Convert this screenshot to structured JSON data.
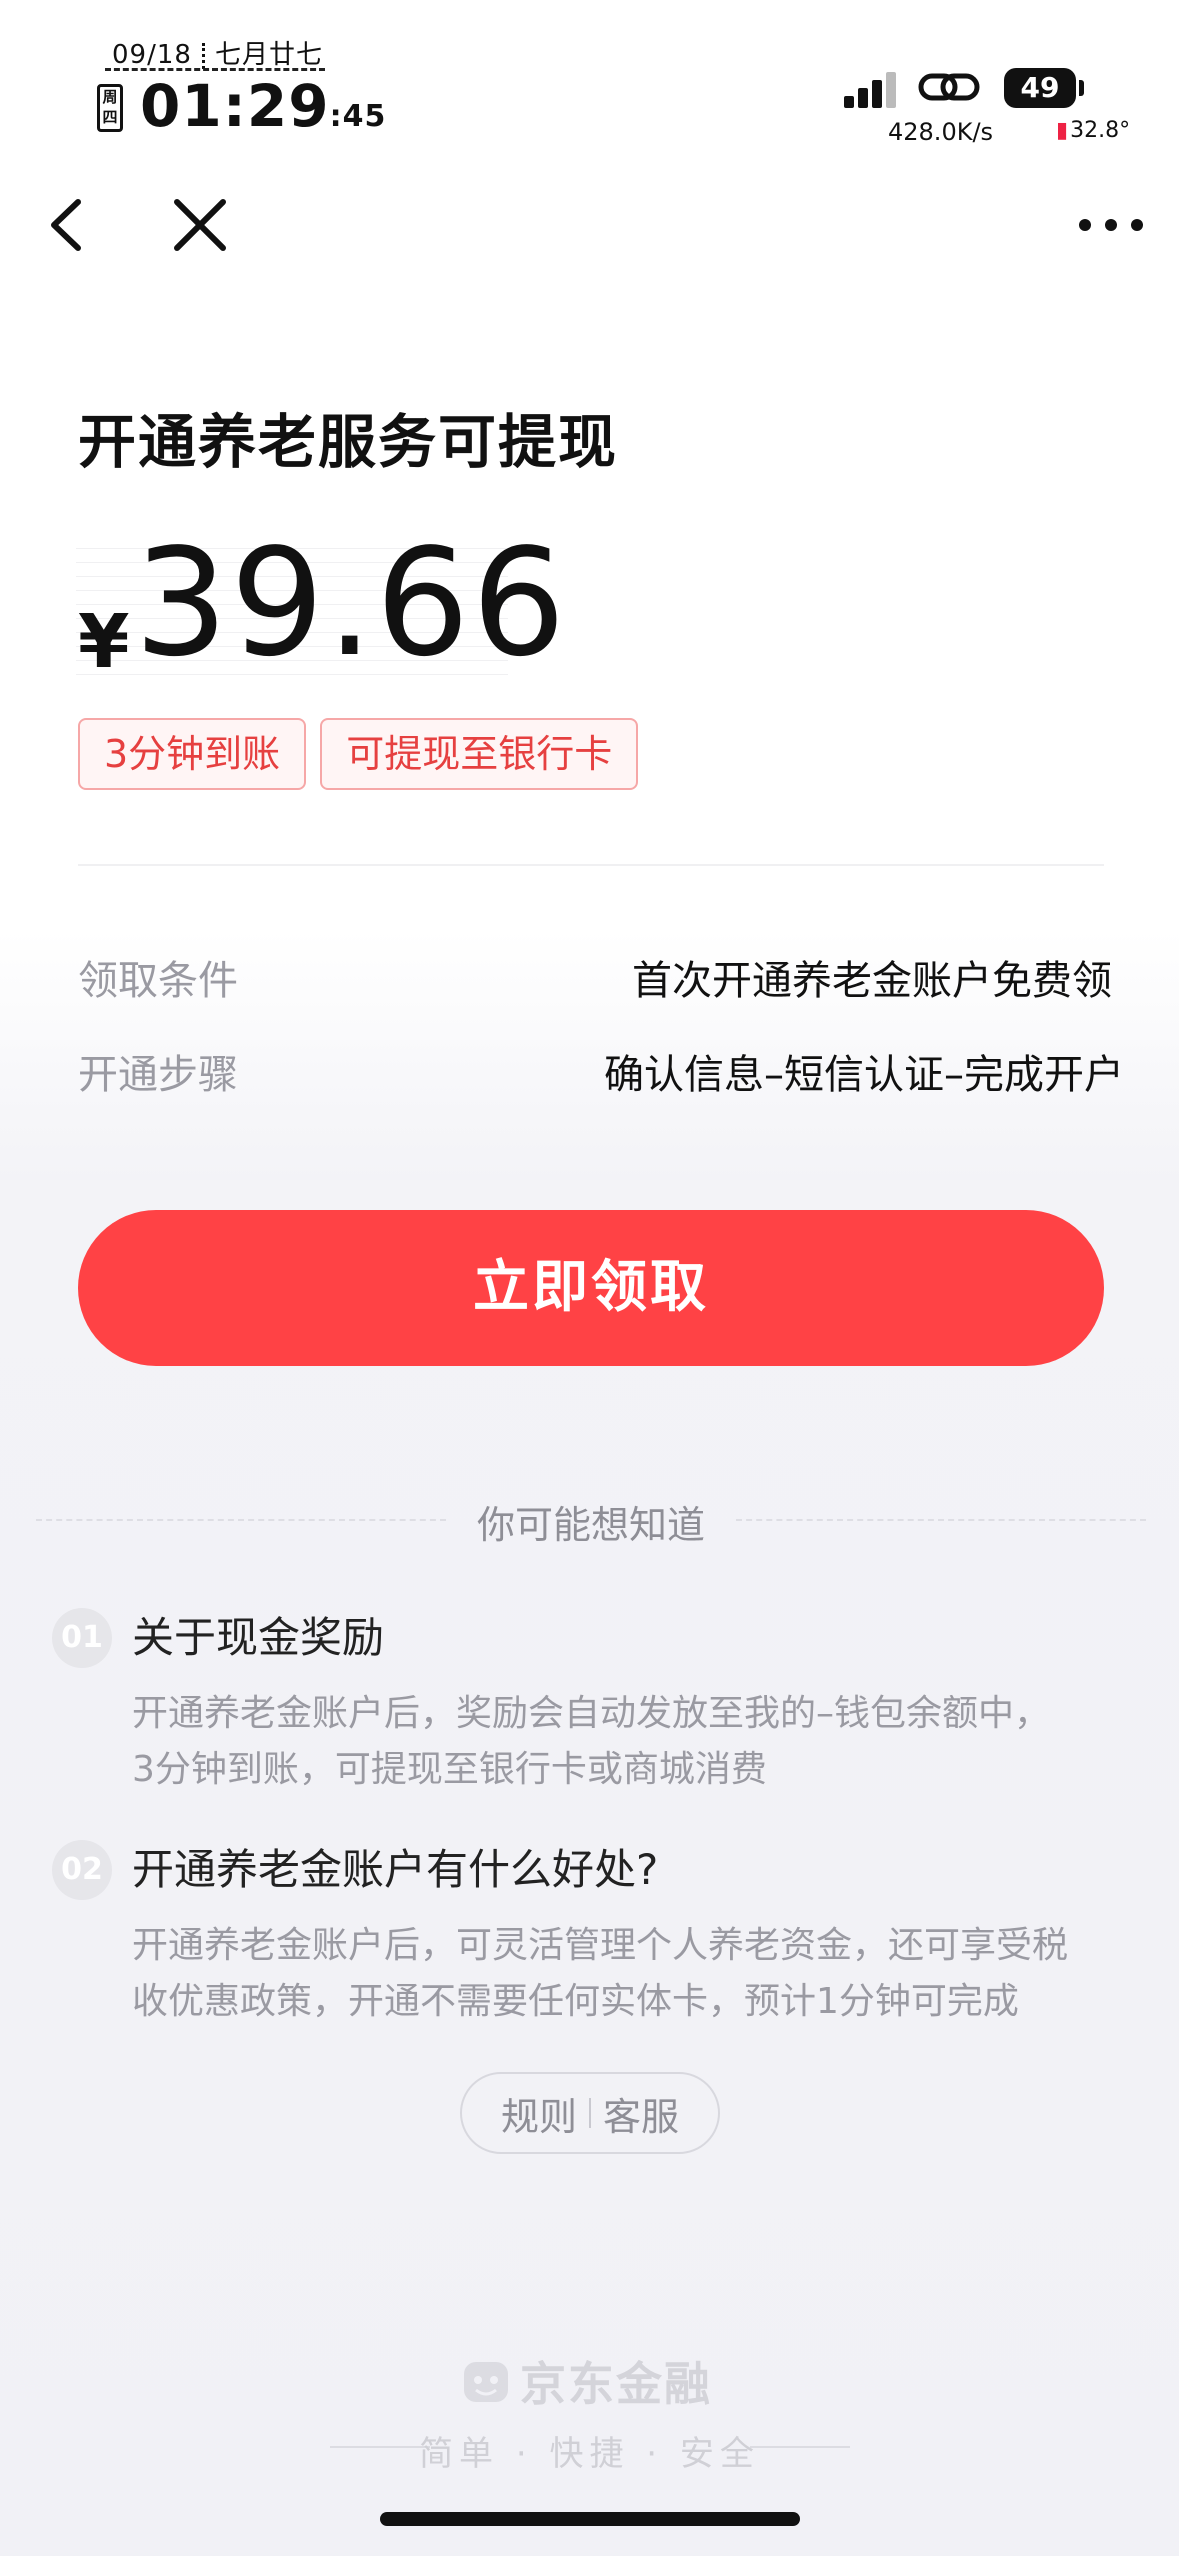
{
  "status_bar": {
    "date": "09/18",
    "lunar": "七月廿七",
    "weekday": "周四",
    "time": "01:29",
    "seconds": ":45",
    "battery": "49",
    "net_speed": "428.0K/s",
    "temperature": "32.8°",
    "icons": [
      "signal-icon",
      "hotspot-link-icon",
      "battery-icon",
      "thermometer-icon"
    ]
  },
  "nav": {
    "icons": [
      "back-arrow-icon",
      "close-icon",
      "more-icon"
    ]
  },
  "hero": {
    "title": "开通养老服务可提现",
    "currency": "¥",
    "amount": "39.66",
    "tags": [
      "3分钟到账",
      "可提现至银行卡"
    ]
  },
  "info": {
    "condition_label": "领取条件",
    "condition_value": "首次开通养老金账户免费领",
    "steps_label": "开通步骤",
    "steps_value": "确认信息–短信认证–完成开户"
  },
  "cta": {
    "label": "立即领取"
  },
  "faq": {
    "heading": "你可能想知道",
    "items": [
      {
        "num": "01",
        "question": "关于现金奖励",
        "answer_line1": "开通养老金账户后，奖励会自动发放至我的–钱包余额中，",
        "answer_line2": "3分钟到账，可提现至银行卡或商城消费"
      },
      {
        "num": "02",
        "question": "开通养老金账户有什么好处?",
        "answer_line1": "开通养老金账户后，可灵活管理个人养老资金，还可享受税",
        "answer_line2": "收优惠政策，开通不需要任何实体卡，预计1分钟可完成"
      }
    ]
  },
  "links": {
    "rules": "规则",
    "service": "客服"
  },
  "footer": {
    "brand": "京东金融",
    "slogan": "简单 · 快捷 · 安全"
  },
  "colors": {
    "accent": "#ff4245",
    "tag_text": "#e64040",
    "muted": "#9a9aa2"
  }
}
